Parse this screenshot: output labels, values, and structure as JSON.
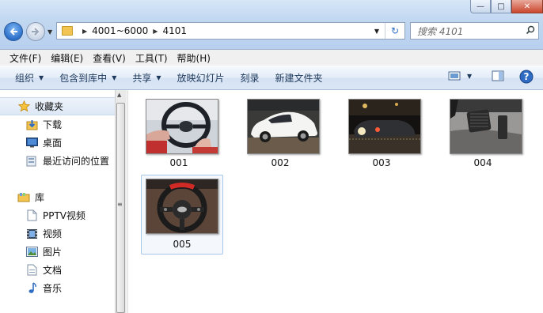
{
  "window": {
    "minimize": "—",
    "maximize": "□",
    "close": "✕"
  },
  "address": {
    "crumbs": [
      "4001~6000",
      "4101"
    ]
  },
  "search": {
    "placeholder": "搜索 4101"
  },
  "menu": [
    "文件(F)",
    "编辑(E)",
    "查看(V)",
    "工具(T)",
    "帮助(H)"
  ],
  "commands": {
    "organize": "组织",
    "include_in_library": "包含到库中",
    "share": "共享",
    "slideshow": "放映幻灯片",
    "burn": "刻录",
    "new_folder": "新建文件夹"
  },
  "nav": {
    "favorites": {
      "label": "收藏夹",
      "items": [
        "下载",
        "桌面",
        "最近访问的位置"
      ]
    },
    "libraries": {
      "label": "库",
      "items": [
        "PPTV视频",
        "视频",
        "图片",
        "文档",
        "音乐"
      ]
    }
  },
  "files": [
    {
      "name": "001",
      "selected": false
    },
    {
      "name": "002",
      "selected": false
    },
    {
      "name": "003",
      "selected": false
    },
    {
      "name": "004",
      "selected": false
    },
    {
      "name": "005",
      "selected": true
    }
  ],
  "colors": {
    "accent": "#2c6fc9",
    "command_text": "#1e395b"
  }
}
